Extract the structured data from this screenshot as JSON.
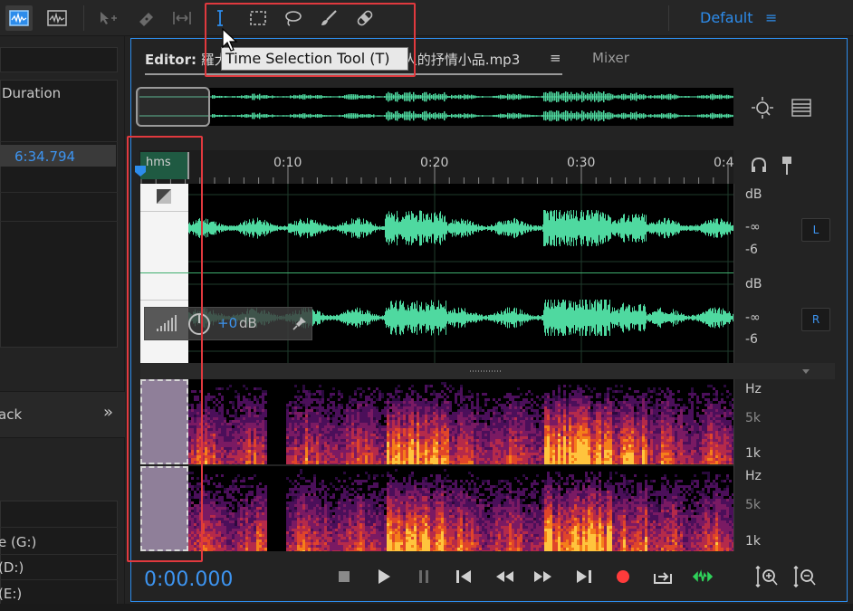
{
  "workspace": {
    "label": "Default",
    "menu_icon": "hamburger-icon"
  },
  "tooltip": "Time Selection Tool (T)",
  "editor": {
    "tab_prefix": "Editor:",
    "tab_file": "羅大佑-戀人的抒情小品.mp3",
    "tab_visible": "羅大",
    "tab_visible_tail": "人的抒情小品.mp3",
    "tab_menu": "≡",
    "mixer_tab": "Mixer"
  },
  "left_panel": {
    "duration_header": "Duration",
    "duration_value": "6:34.794",
    "tab_label": "ack",
    "tab_arrow": "»",
    "drives": [
      "e (G:)",
      "(D:)",
      "(E:)"
    ]
  },
  "ruler": {
    "hms_label": "hms",
    "ticks": [
      "0:10",
      "0:20",
      "0:30",
      "0:4"
    ]
  },
  "waveform": {
    "channel_left": "L",
    "channel_right": "R",
    "db_label": "dB",
    "inf_label": "-∞",
    "six_label": "-6",
    "hud_value": "+0",
    "hud_unit": "dB",
    "accent_color": "#4fd9a0"
  },
  "spectral": {
    "hz_label": "Hz",
    "k5_label": "5k",
    "k1_label": "1k"
  },
  "transport": {
    "timecode": "0:00.000",
    "record_color": "#ff3b3b",
    "loop_color": "#2fd15a"
  },
  "colors": {
    "accent": "#2d8ceb",
    "highlight": "#e0393e"
  }
}
